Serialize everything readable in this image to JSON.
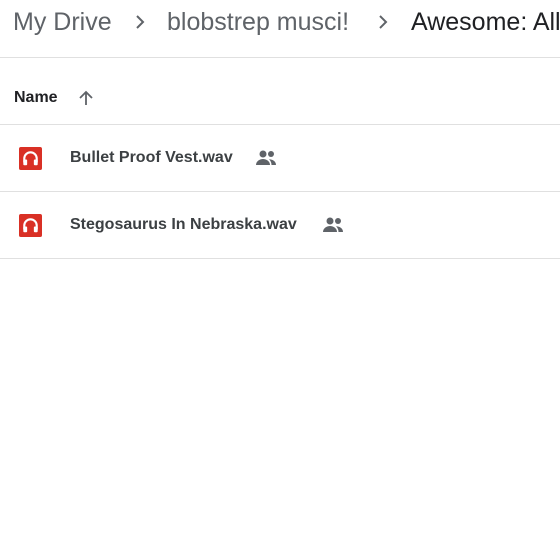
{
  "breadcrumb": {
    "items": [
      "My Drive",
      "blobstrep musci!",
      "Awesome: All"
    ]
  },
  "table": {
    "name_header": "Name",
    "sort_direction": "ascending",
    "rows": [
      {
        "name": "Bullet Proof Vest.wav",
        "icon": "audio-file-icon",
        "shared": true
      },
      {
        "name": "Stegosaurus In Nebraska.wav",
        "icon": "audio-file-icon",
        "shared": true
      }
    ]
  },
  "colors": {
    "audio_icon": "#d93025",
    "text_primary": "#202124",
    "text_secondary": "#5f6368",
    "divider": "#e0e0e0"
  }
}
